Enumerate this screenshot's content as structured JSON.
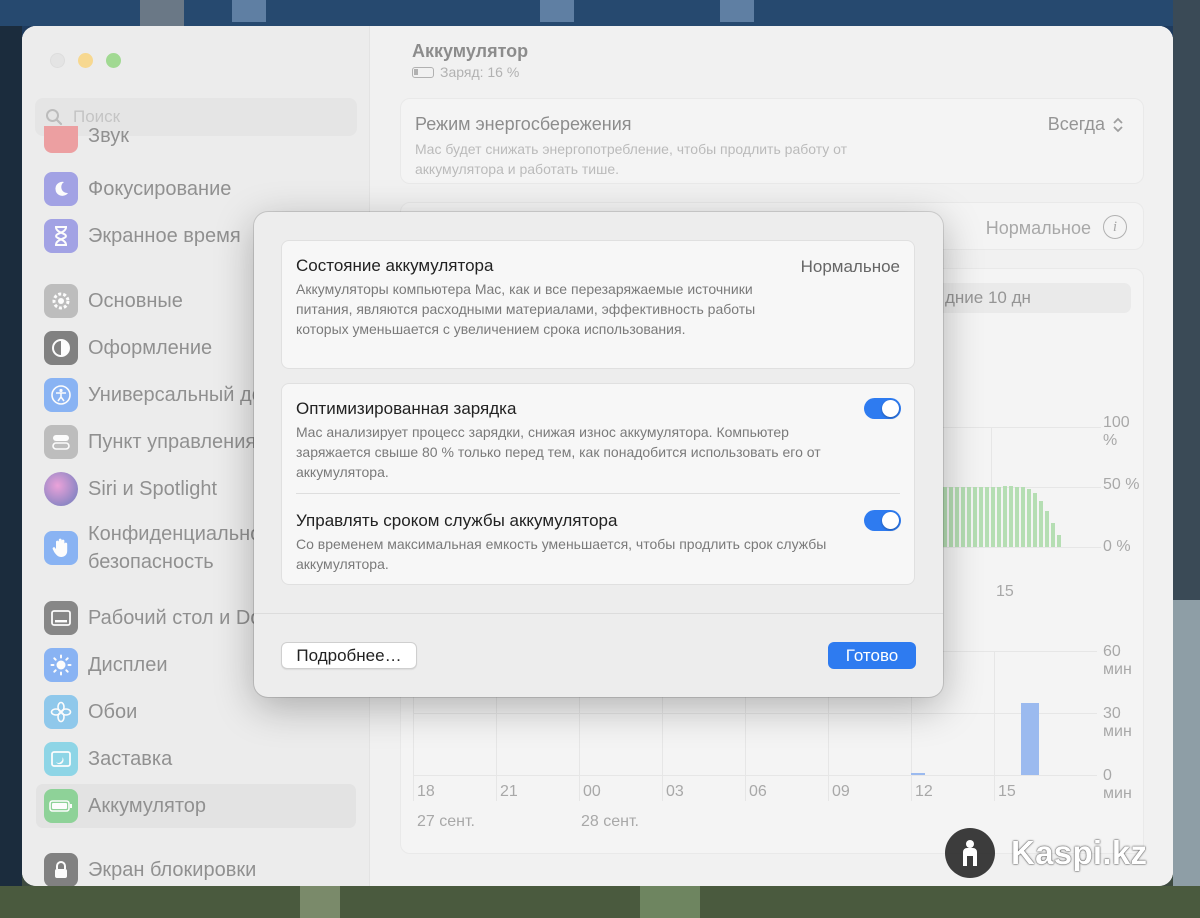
{
  "window": {
    "search_placeholder": "Поиск",
    "sidebar": [
      {
        "label": "Звук",
        "icon": "speaker-icon"
      },
      {
        "label": "Фокусирование",
        "icon": "moon-icon"
      },
      {
        "label": "Экранное время",
        "icon": "hourglass-icon"
      },
      {
        "label": "Основные",
        "icon": "gear-icon"
      },
      {
        "label": "Оформление",
        "icon": "appearance-icon"
      },
      {
        "label": "Универсальный доступ",
        "icon": "accessibility-icon"
      },
      {
        "label": "Пункт управления",
        "icon": "control-center-icon"
      },
      {
        "label": "Siri и Spotlight",
        "icon": "siri-icon"
      },
      {
        "label": "Конфиденциальность и безопасность",
        "icon": "hand-icon"
      },
      {
        "label": "Рабочий стол и Dock",
        "icon": "desktop-dock-icon"
      },
      {
        "label": "Дисплеи",
        "icon": "sun-icon"
      },
      {
        "label": "Обои",
        "icon": "flower-icon"
      },
      {
        "label": "Заставка",
        "icon": "screensaver-icon"
      },
      {
        "label": "Аккумулятор",
        "icon": "battery-icon"
      },
      {
        "label": "Экран блокировки",
        "icon": "lock-icon"
      }
    ],
    "main": {
      "title": "Аккумулятор",
      "charge_text": "Заряд: 16 %",
      "low_power": {
        "title": "Режим энергосбережения",
        "description": "Mac будет снижать энергопотребление, чтобы продлить работу от аккумулятора и работать тише.",
        "value": "Всегда"
      },
      "health_state": "Нормальное",
      "range_tab": "дние 10 дн",
      "level_chart_y": [
        "100 %",
        "50 %",
        "0 %"
      ],
      "level_chart_x": [
        "15"
      ],
      "usage_chart_y": [
        "60 мин",
        "30 мин",
        "0 мин"
      ],
      "usage_chart_x": [
        "18",
        "21",
        "00",
        "03",
        "06",
        "09",
        "12",
        "15"
      ],
      "usage_chart_dates": [
        "27 сент.",
        "28 сент."
      ]
    }
  },
  "sheet": {
    "health": {
      "title": "Состояние аккумулятора",
      "value": "Нормальное",
      "description": "Аккумуляторы компьютера Mac, как и все перезаряжаемые источники питания, являются расходными материалами, эффективность работы которых уменьшается с увеличением срока использования."
    },
    "optimized": {
      "title": "Оптимизированная зарядка",
      "description": "Mac анализирует процесс зарядки, снижая износ аккумулятора. Компьютер заряжается свыше 80 % только перед тем, как понадобится использовать его от аккумулятора.",
      "enabled": true
    },
    "manage": {
      "title": "Управлять сроком службы аккумулятора",
      "description": "Со временем максимальная емкость уменьшается, чтобы продлить срок службы аккумулятора.",
      "enabled": true
    },
    "more_button": "Подробнее…",
    "done_button": "Готово"
  },
  "watermark": "Kaspi.kz",
  "colors": {
    "accent": "#2e7bf0",
    "chart_green": "#7fc97a",
    "chart_blue": "#4f87e8"
  }
}
